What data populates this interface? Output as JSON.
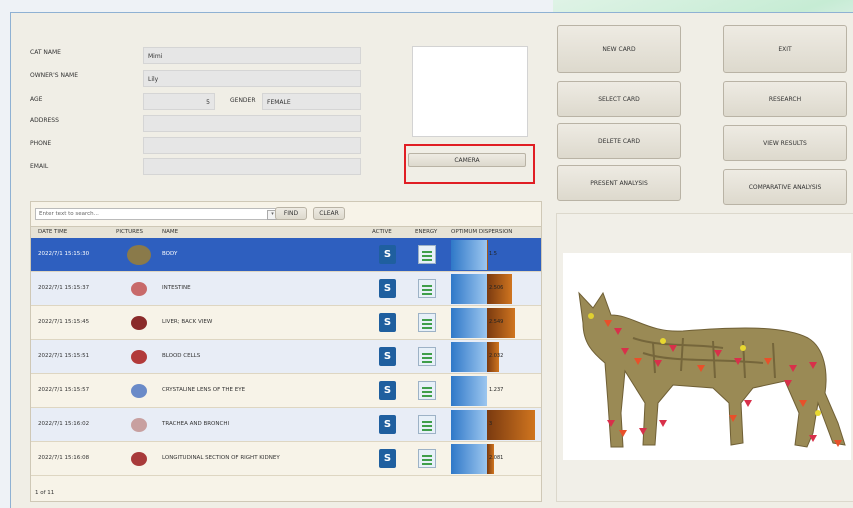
{
  "form": {
    "cat_name_label": "CAT NAME",
    "cat_name_value": "Mimi",
    "owner_label": "OWNER'S NAME",
    "owner_value": "Lily",
    "age_label": "AGE",
    "age_value": "5",
    "gender_label": "GENDER",
    "gender_value": "FEMALE",
    "address_label": "ADDRESS",
    "phone_label": "PHONE",
    "email_label": "EMAIL"
  },
  "buttons": {
    "camera": "CAMERA",
    "new_card": "NEW CARD",
    "exit": "EXIT",
    "select_card": "SELECT CARD",
    "research": "RESEARCH",
    "delete_card": "DELETE CARD",
    "view_results": "VIEW RESULTS",
    "present_analysis": "PRESENT ANALYSIS",
    "comparative_analysis": "COMPARATIVE ANALYSIS"
  },
  "search": {
    "placeholder": "Enter text to search...",
    "find": "Find",
    "clear": "Clear"
  },
  "table": {
    "headers": [
      "DATE TIME",
      "PICTURES",
      "NAME",
      "ACTIVE",
      "ENERGY",
      "OPTIMUM DISPERSION"
    ],
    "rows": [
      {
        "date": "2022/7/1 15:15:30",
        "name": "BODY",
        "value": "1.5",
        "disp": 0.02
      },
      {
        "date": "2022/7/1 15:15:37",
        "name": "INTESTINE",
        "value": "2.506",
        "disp": 0.42
      },
      {
        "date": "2022/7/1 15:15:45",
        "name": "LIVER; back view",
        "value": "2.549",
        "disp": 0.47
      },
      {
        "date": "2022/7/1 15:15:51",
        "name": "BLOOD CELLS",
        "value": "2.032",
        "disp": 0.2
      },
      {
        "date": "2022/7/1 15:15:57",
        "name": "CRYSTALINE LENS OF THE EYE",
        "value": "1.237",
        "disp": 0.0
      },
      {
        "date": "2022/7/1 15:16:02",
        "name": "TRACHEA AND BRONCHI",
        "value": "3",
        "disp": 0.8
      },
      {
        "date": "2022/7/1 15:16:08",
        "name": "LONGITUDINAL SECTION OF RIGHT KIDNEY",
        "value": "2.081",
        "disp": 0.12
      }
    ],
    "pager": "1 of 11"
  }
}
